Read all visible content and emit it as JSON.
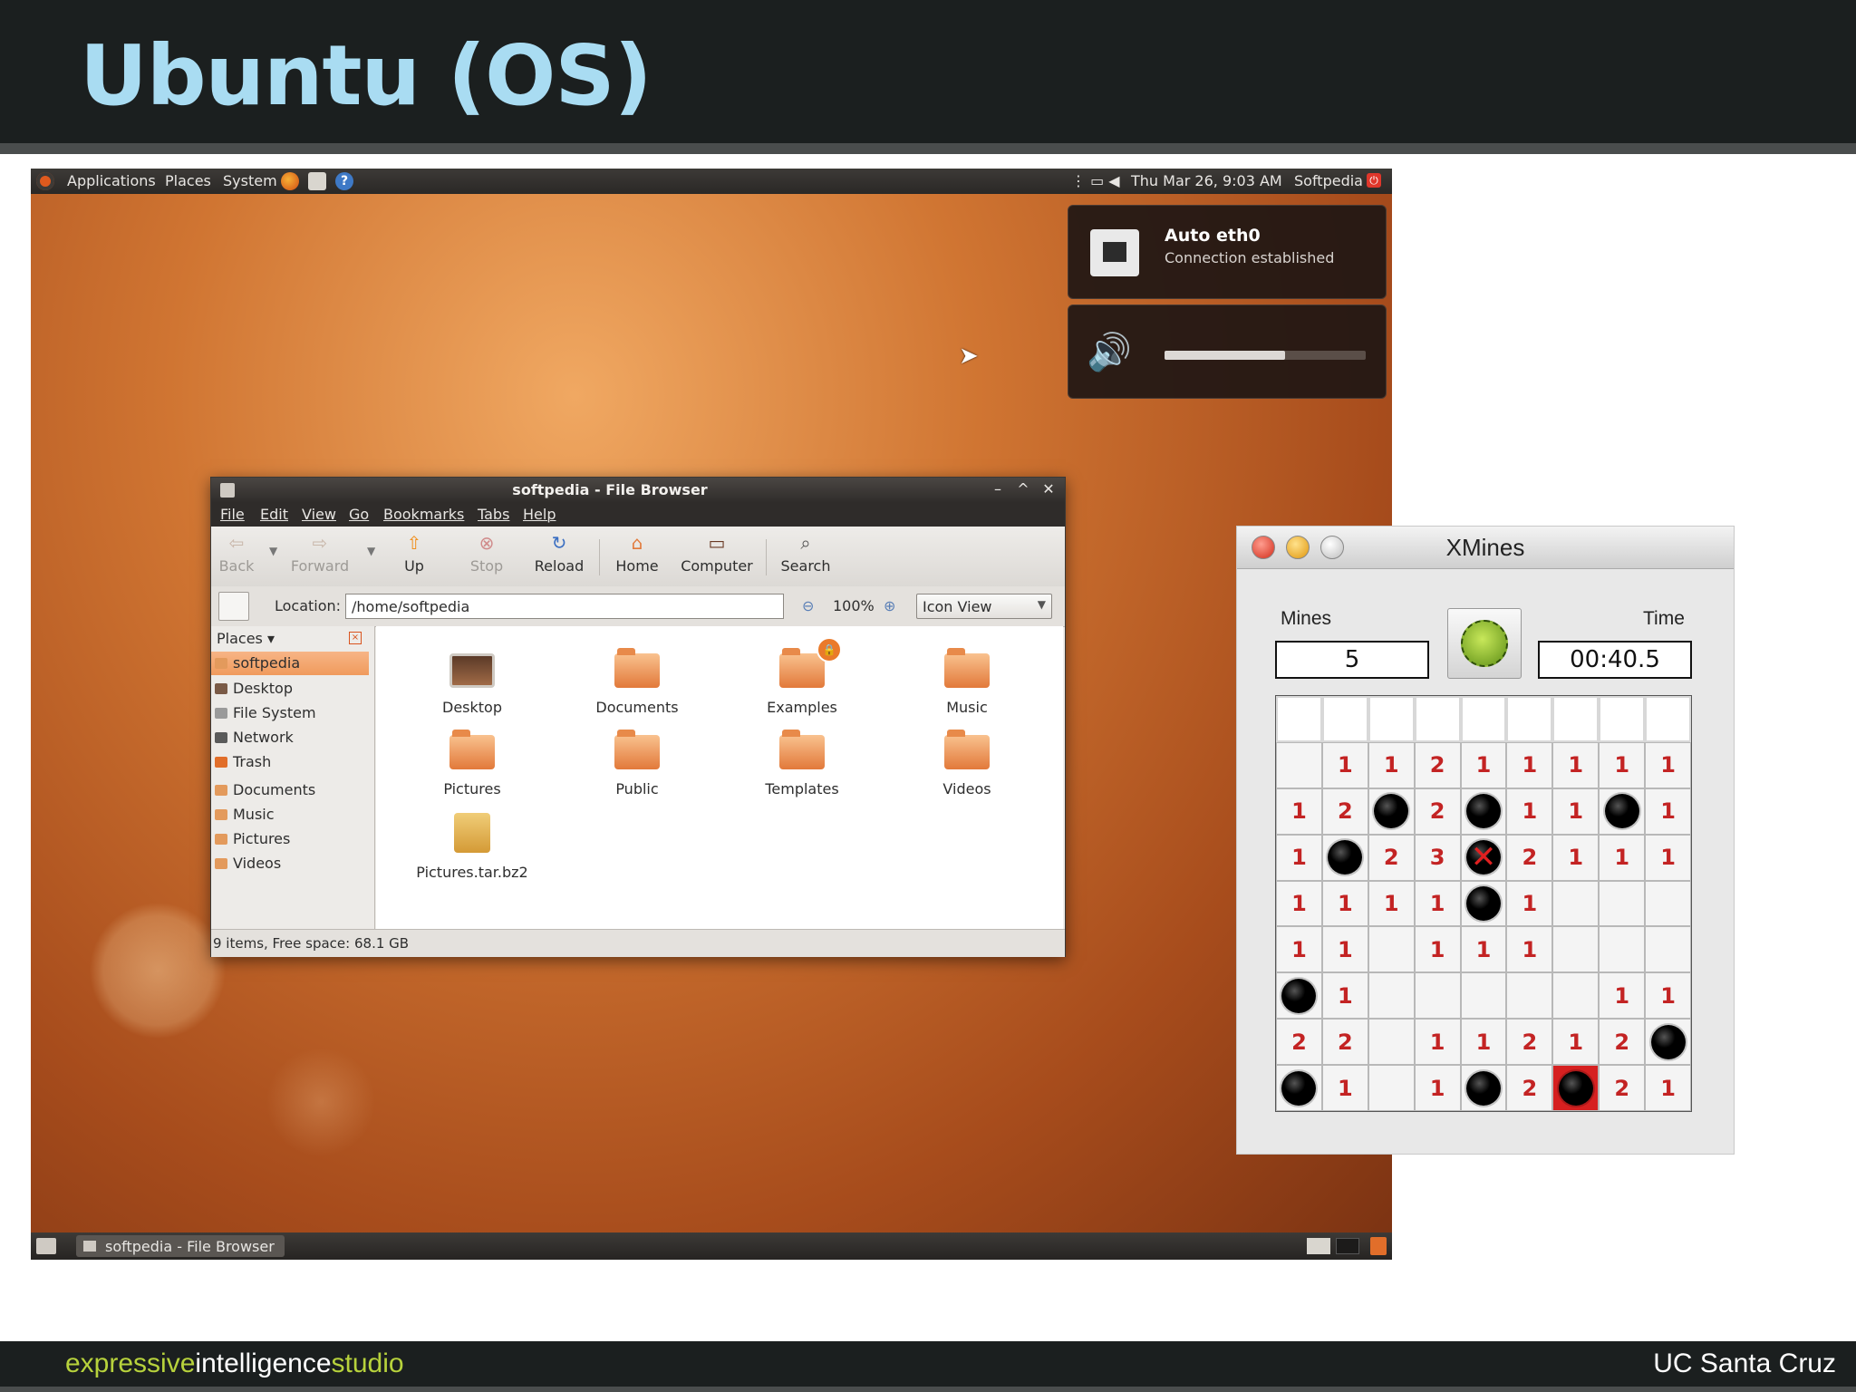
{
  "slide": {
    "title": "Ubuntu (OS)",
    "footer_left": [
      "expressive",
      "intelligence",
      "studio"
    ],
    "footer_right": "UC Santa Cruz",
    "colors": {
      "title": "#a9dcf2",
      "header_bg": "#1b1f1f",
      "footer_accent": "#b7d23c"
    }
  },
  "top_panel": {
    "menus": [
      "Applications",
      "Places",
      "System"
    ],
    "launchers": [
      "firefox-icon",
      "mail-icon",
      "help-icon"
    ],
    "clock": "Thu Mar 26,  9:03 AM",
    "user": "Softpedia"
  },
  "notifications": {
    "network": {
      "title": "Auto eth0",
      "body": "Connection established"
    },
    "volume": {
      "level": 0.6
    }
  },
  "file_browser": {
    "title": "softpedia - File Browser",
    "menu": [
      "File",
      "Edit",
      "View",
      "Go",
      "Bookmarks",
      "Tabs",
      "Help"
    ],
    "toolbar": {
      "back": "Back",
      "forward": "Forward",
      "up": "Up",
      "stop": "Stop",
      "reload": "Reload",
      "home": "Home",
      "computer": "Computer",
      "search": "Search"
    },
    "location_label": "Location:",
    "location_value": "/home/softpedia",
    "zoom": "100%",
    "view_mode": "Icon View",
    "places_header": "Places",
    "places": [
      "softpedia",
      "Desktop",
      "File System",
      "Network",
      "Trash"
    ],
    "bookmarks": [
      "Documents",
      "Music",
      "Pictures",
      "Videos"
    ],
    "items": [
      "Desktop",
      "Documents",
      "Examples",
      "Music",
      "Pictures",
      "Public",
      "Templates",
      "Videos",
      "Pictures.tar.bz2"
    ],
    "status": "9 items, Free space: 68.1 GB"
  },
  "taskbar": {
    "task": "softpedia - File Browser"
  },
  "xmines": {
    "title": "XMines",
    "mines_label": "Mines",
    "time_label": "Time",
    "mines": "5",
    "time": "00:40.5",
    "board": [
      [
        "H",
        "H",
        "H",
        "H",
        "H",
        "H",
        "H",
        "H",
        "H"
      ],
      [
        "",
        "1",
        "1",
        "2",
        "1",
        "1",
        "1",
        "1",
        "1"
      ],
      [
        "1",
        "2",
        "M",
        "2",
        "M",
        "1",
        "1",
        "M",
        "1"
      ],
      [
        "1",
        "M",
        "2",
        "3",
        "X",
        "2",
        "1",
        "1",
        "1"
      ],
      [
        "1",
        "1",
        "1",
        "1",
        "M",
        "1",
        "",
        "",
        ""
      ],
      [
        "1",
        "1",
        "",
        "1",
        "1",
        "1",
        "",
        "",
        ""
      ],
      [
        "M",
        "1",
        "",
        "",
        "",
        "",
        "",
        "1",
        "1"
      ],
      [
        "2",
        "2",
        "",
        "1",
        "1",
        "2",
        "1",
        "2",
        "M"
      ],
      [
        "M",
        "1",
        "",
        "1",
        "M",
        "2",
        "B",
        "2",
        "1"
      ]
    ]
  }
}
